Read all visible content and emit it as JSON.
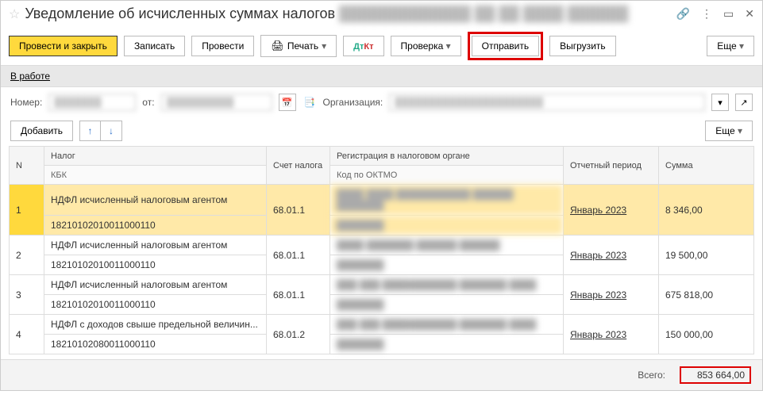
{
  "title": "Уведомление об исчисленных суммах налогов",
  "title_blur": "█████████████ ██ ██ ████ ██████",
  "toolbar": {
    "save_close": "Провести и закрыть",
    "save": "Записать",
    "post": "Провести",
    "print": "Печать",
    "check": "Проверка",
    "send": "Отправить",
    "export": "Выгрузить",
    "more": "Еще"
  },
  "status": {
    "label": "В работе"
  },
  "fields": {
    "number_label": "Номер:",
    "number_value": "███████",
    "from_label": "от:",
    "from_value": "██████████",
    "org_label": "Организация:",
    "org_value": "██████████████████████"
  },
  "subtoolbar": {
    "add": "Добавить",
    "more": "Еще"
  },
  "headers": {
    "n": "N",
    "tax": "Налог",
    "kbk": "КБК",
    "acc": "Счет налога",
    "reg": "Регистрация в налоговом органе",
    "oktmo": "Код по ОКТМО",
    "period": "Отчетный период",
    "sum": "Сумма"
  },
  "rows": [
    {
      "n": "1",
      "tax": "НДФЛ исчисленный налоговым агентом",
      "kbk": "18210102010011000110",
      "acc": "68.01.1",
      "reg_blur": "████ ████ ███████████ ██████ ███████",
      "oktmo_blur": "███████",
      "period": "Январь 2023",
      "sum": "8 346,00"
    },
    {
      "n": "2",
      "tax": "НДФЛ исчисленный налоговым агентом",
      "kbk": "18210102010011000110",
      "acc": "68.01.1",
      "reg_blur": "████ ███████ ██████ ██████",
      "oktmo_blur": "███████",
      "period": "Январь 2023",
      "sum": "19 500,00"
    },
    {
      "n": "3",
      "tax": "НДФЛ исчисленный налоговым агентом",
      "kbk": "18210102010011000110",
      "acc": "68.01.1",
      "reg_blur": "███ ███ ███████████ ███████ ████",
      "oktmo_blur": "███████",
      "period": "Январь 2023",
      "sum": "675 818,00"
    },
    {
      "n": "4",
      "tax": "НДФЛ с доходов свыше предельной величин...",
      "kbk": "18210102080011000110",
      "acc": "68.01.2",
      "reg_blur": "███ ███ ███████████ ███████ ████",
      "oktmo_blur": "███████",
      "period": "Январь 2023",
      "sum": "150 000,00"
    }
  ],
  "footer": {
    "total_label": "Всего:",
    "total_value": "853 664,00"
  }
}
